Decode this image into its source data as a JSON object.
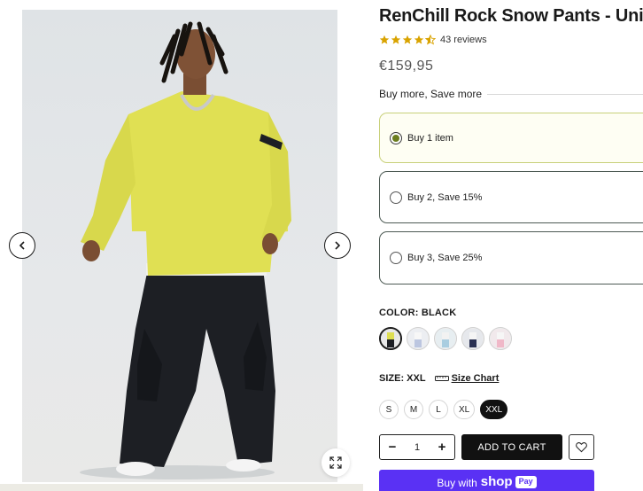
{
  "product": {
    "title": "RenChill Rock Snow Pants - Unisex",
    "rating": 4.5,
    "reviews_text": "43 reviews",
    "price": "€159,95"
  },
  "bundles": {
    "heading": "Buy more, Save more",
    "items": [
      {
        "label": "Buy 1 item",
        "selected": true
      },
      {
        "label": "Buy 2, Save 15%",
        "selected": false
      },
      {
        "label": "Buy 3, Save 25%",
        "selected": false
      }
    ]
  },
  "color": {
    "label": "COLOR: BLACK",
    "swatches": [
      "black-yellow",
      "white-blue",
      "light-blue",
      "navy-white",
      "pink"
    ],
    "selected_index": 0
  },
  "size": {
    "label": "SIZE: XXL",
    "chart_link": "Size Chart",
    "options": [
      "S",
      "M",
      "L",
      "XL",
      "XXL"
    ],
    "selected": "XXL"
  },
  "cart": {
    "quantity": "1",
    "minus": "−",
    "plus": "+",
    "add_label": "ADD TO CART",
    "shop_pay_prefix": "Buy with",
    "shop_pay_brand": "shop",
    "shop_pay_badge": "Pay"
  },
  "colors": {
    "accent_purple": "#5a31f4",
    "selected_radio": "#6b7d1e",
    "button_dark": "#111111"
  },
  "icons": {
    "prev": "chevron-left-icon",
    "next": "chevron-right-icon",
    "zoom": "expand-icon",
    "wishlist": "heart-icon",
    "size_chart": "ruler-icon",
    "rating": "star-icon"
  }
}
